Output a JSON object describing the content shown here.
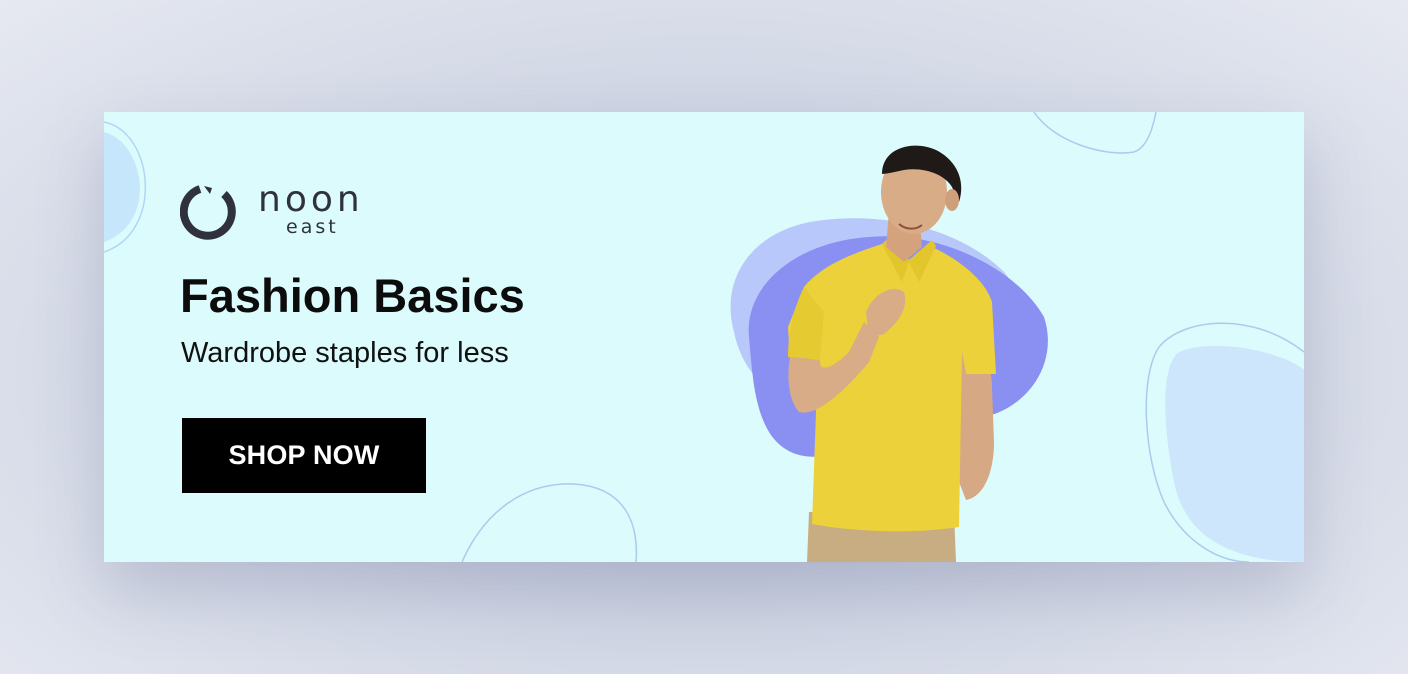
{
  "brand": {
    "name": "noon",
    "sub": "east",
    "logo_icon": "noon-logo-icon"
  },
  "promo": {
    "title": "Fashion Basics",
    "subtitle": "Wardrobe staples for less",
    "cta_label": "SHOP NOW"
  },
  "colors": {
    "background": "#dcfbfc",
    "blob_light": "#b9c8fb",
    "blob_dark": "#8a8ff2",
    "shirt": "#ecd13a",
    "button": "#000000"
  }
}
